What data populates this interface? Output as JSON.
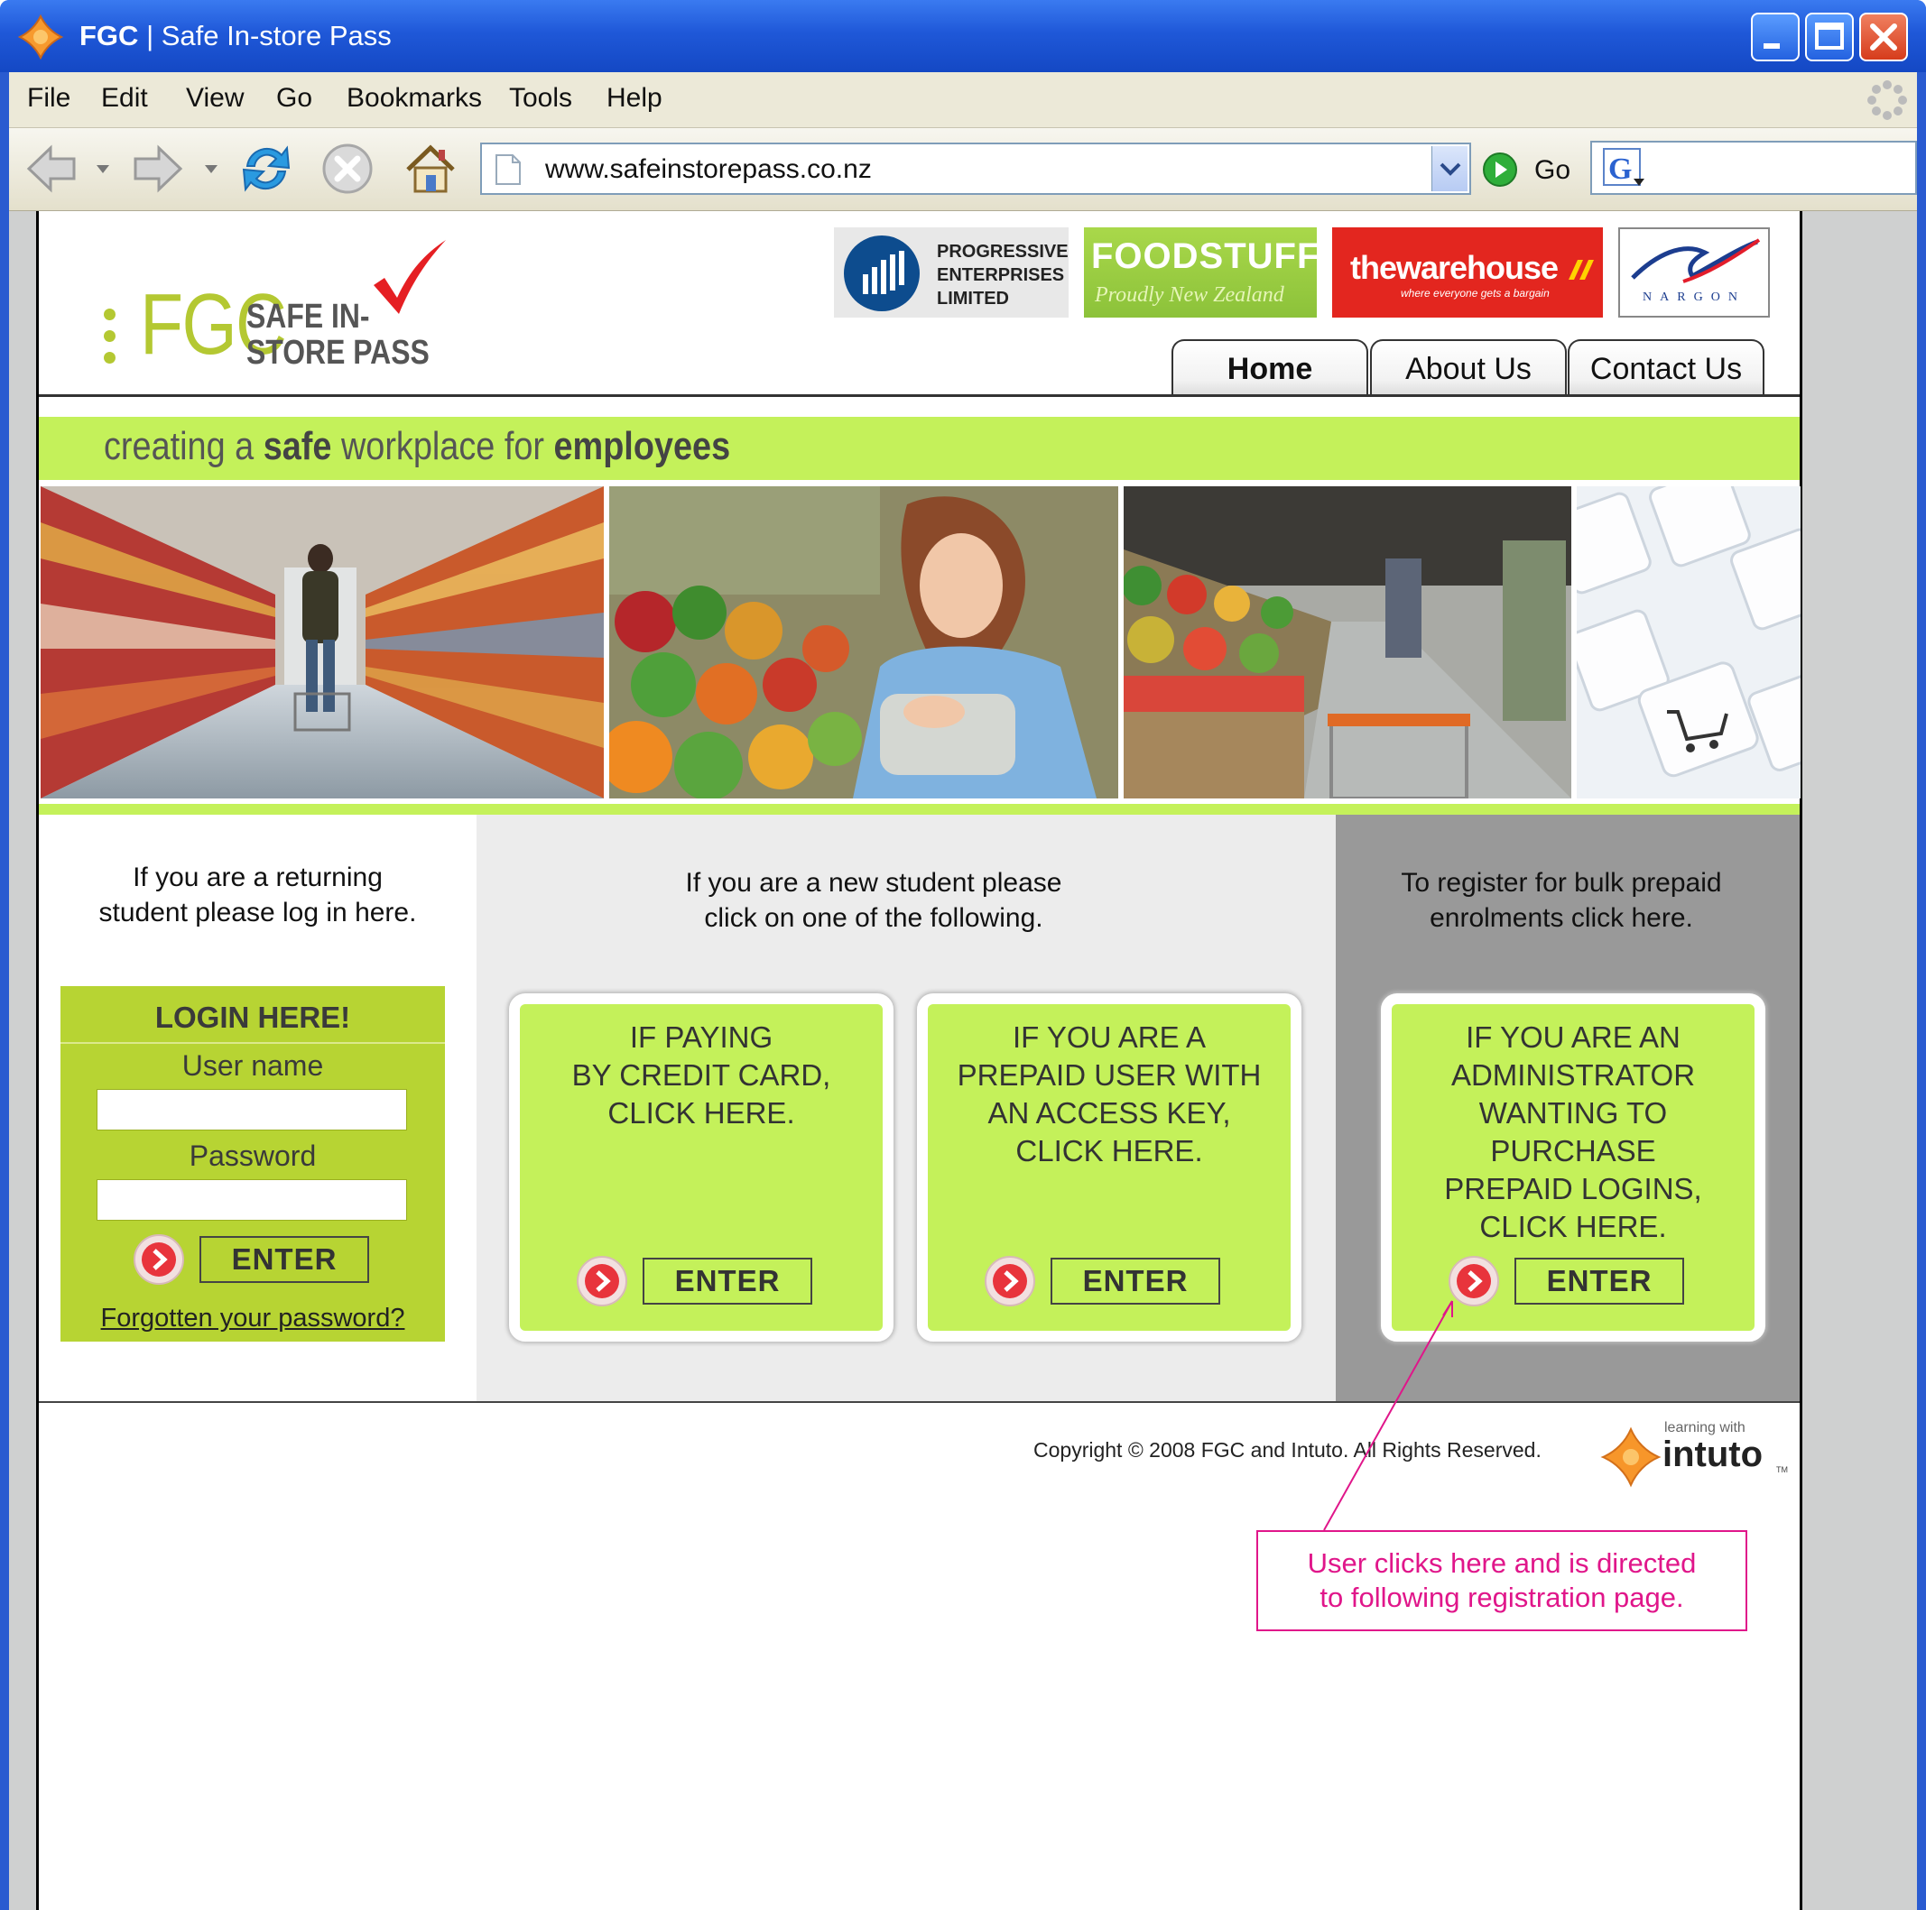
{
  "window": {
    "title_app": "FGC",
    "title_sep": "|",
    "title_page": "Safe In-store Pass"
  },
  "menu": [
    "File",
    "Edit",
    "View",
    "Go",
    "Bookmarks",
    "Tools",
    "Help"
  ],
  "toolbar": {
    "url": "www.safeinstorepass.co.nz",
    "go_label": "Go"
  },
  "site": {
    "logo": {
      "fgc": "FGC",
      "line1": "SAFE IN-",
      "line2": "STORE PASS"
    },
    "partners": {
      "progressive": [
        "PROGRESSIVE",
        "ENTERPRISES",
        "LIMITED"
      ],
      "foodstuffs": "FOODSTUFFS",
      "foodstuffs_tagline": "Proudly New Zealand",
      "warehouse": "thewarehouse",
      "warehouse_tagline": "where everyone gets a bargain",
      "nargon": "NARGON"
    },
    "nav": [
      "Home",
      "About Us",
      "Contact Us"
    ],
    "tagline": {
      "p1": "creating a ",
      "b1": "safe",
      "p2": " workplace for ",
      "b2": "employees"
    },
    "returning": {
      "intro": [
        "If you are a returning",
        "student please log in here."
      ],
      "title": "LOGIN HERE!",
      "username_label": "User name",
      "password_label": "Password",
      "enter": "ENTER",
      "forgot": "Forgotten your password?"
    },
    "new_student": {
      "intro": [
        "If you are a new student please",
        "click on one of the following."
      ],
      "card1": [
        "IF PAYING",
        "BY CREDIT CARD,",
        "CLICK HERE."
      ],
      "card2": [
        "IF YOU ARE A",
        "PREPAID USER WITH",
        "AN ACCESS KEY,",
        "CLICK HERE."
      ],
      "enter": "ENTER"
    },
    "bulk": {
      "intro": [
        "To register for bulk prepaid",
        "enrolments click here."
      ],
      "card": [
        "IF YOU ARE AN",
        "ADMINISTRATOR",
        "WANTING TO",
        "PURCHASE",
        "PREPAID LOGINS,",
        "CLICK HERE."
      ],
      "enter": "ENTER"
    },
    "copyright": "Copyright © 2008 FGC and Intuto. All Rights Reserved.",
    "intuto": {
      "small": "learning with",
      "big": "intuto",
      "tm": "TM"
    }
  },
  "annotation": [
    "User clicks here and is directed",
    "to following registration page."
  ],
  "colors": {
    "accent_green": "#c4f15a",
    "login_green": "#b7d433",
    "annotation_pink": "#e0168a",
    "titlebar_blue": "#1f58d8"
  }
}
